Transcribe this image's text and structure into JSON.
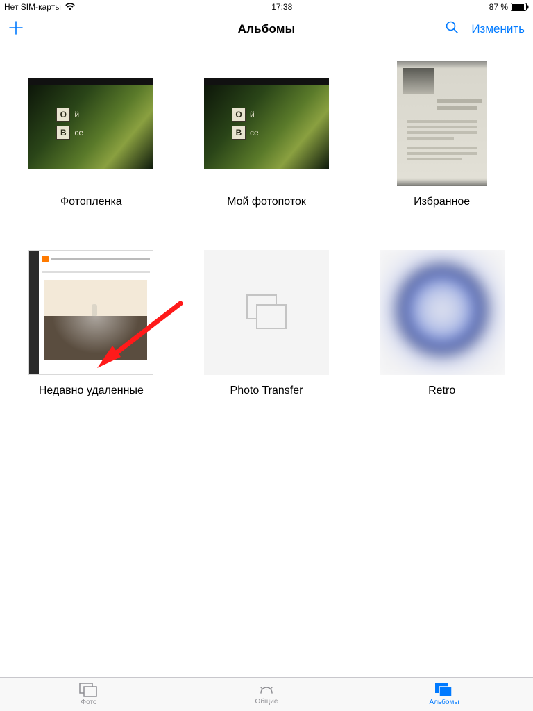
{
  "status": {
    "carrier": "Нет SIM-карты",
    "time": "17:38",
    "battery_pct": "87 %"
  },
  "nav": {
    "title": "Альбомы",
    "edit": "Изменить"
  },
  "albums": [
    {
      "name": "Фотопленка"
    },
    {
      "name": "Мой фотопоток"
    },
    {
      "name": "Избранное"
    },
    {
      "name": "Недавно удаленные"
    },
    {
      "name": "Photo Transfer"
    },
    {
      "name": "Retro"
    }
  ],
  "tabs": {
    "photos": "Фото",
    "shared": "Общие",
    "albums": "Альбомы"
  },
  "colors": {
    "tint": "#007aff",
    "inactive": "#8e8e93"
  }
}
